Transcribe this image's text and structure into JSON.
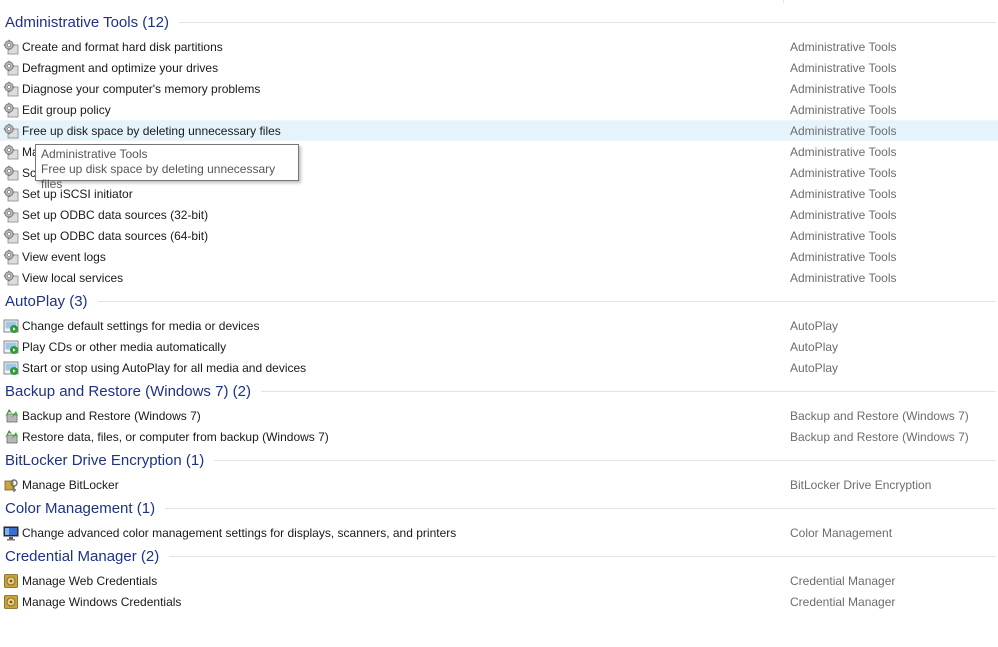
{
  "groups": [
    {
      "title": "Administrative Tools (12)",
      "icon": "admin-tools-gear-icon",
      "items": [
        {
          "label": "Create and format hard disk partitions",
          "category": "Administrative Tools"
        },
        {
          "label": "Defragment and optimize your drives",
          "category": "Administrative Tools"
        },
        {
          "label": "Diagnose your computer's memory problems",
          "category": "Administrative Tools"
        },
        {
          "label": "Edit group policy",
          "category": "Administrative Tools"
        },
        {
          "label": "Free up disk space by deleting unnecessary files",
          "category": "Administrative Tools"
        },
        {
          "label": "Ma",
          "category": "Administrative Tools"
        },
        {
          "label": "Sc",
          "category": "Administrative Tools"
        },
        {
          "label": "Set up iSCSI initiator",
          "category": "Administrative Tools"
        },
        {
          "label": "Set up ODBC data sources (32-bit)",
          "category": "Administrative Tools"
        },
        {
          "label": "Set up ODBC data sources (64-bit)",
          "category": "Administrative Tools"
        },
        {
          "label": "View event logs",
          "category": "Administrative Tools"
        },
        {
          "label": "View local services",
          "category": "Administrative Tools"
        }
      ]
    },
    {
      "title": "AutoPlay (3)",
      "icon": "autoplay-icon",
      "items": [
        {
          "label": "Change default settings for media or devices",
          "category": "AutoPlay"
        },
        {
          "label": "Play CDs or other media automatically",
          "category": "AutoPlay"
        },
        {
          "label": "Start or stop using AutoPlay for all media and devices",
          "category": "AutoPlay"
        }
      ]
    },
    {
      "title": "Backup and Restore (Windows 7) (2)",
      "icon": "backup-restore-icon",
      "items": [
        {
          "label": "Backup and Restore (Windows 7)",
          "category": "Backup and Restore (Windows 7)"
        },
        {
          "label": "Restore data, files, or computer from backup (Windows 7)",
          "category": "Backup and Restore (Windows 7)"
        }
      ]
    },
    {
      "title": "BitLocker Drive Encryption (1)",
      "icon": "bitlocker-key-icon",
      "items": [
        {
          "label": "Manage BitLocker",
          "category": "BitLocker Drive Encryption"
        }
      ]
    },
    {
      "title": "Color Management (1)",
      "icon": "color-management-monitor-icon",
      "items": [
        {
          "label": "Change advanced color management settings for displays, scanners, and printers",
          "category": "Color Management"
        }
      ]
    },
    {
      "title": "Credential Manager (2)",
      "icon": "credential-manager-vault-icon",
      "items": [
        {
          "label": "Manage Web Credentials",
          "category": "Credential Manager"
        },
        {
          "label": "Manage Windows Credentials",
          "category": "Credential Manager"
        }
      ]
    }
  ],
  "tooltip": {
    "title": "Administrative Tools",
    "description": "Free up disk space by deleting unnecessary files"
  },
  "colors": {
    "group_title": "#1e3287",
    "hover_row": "#e5f3fb",
    "category_text": "#6d6d6d"
  }
}
